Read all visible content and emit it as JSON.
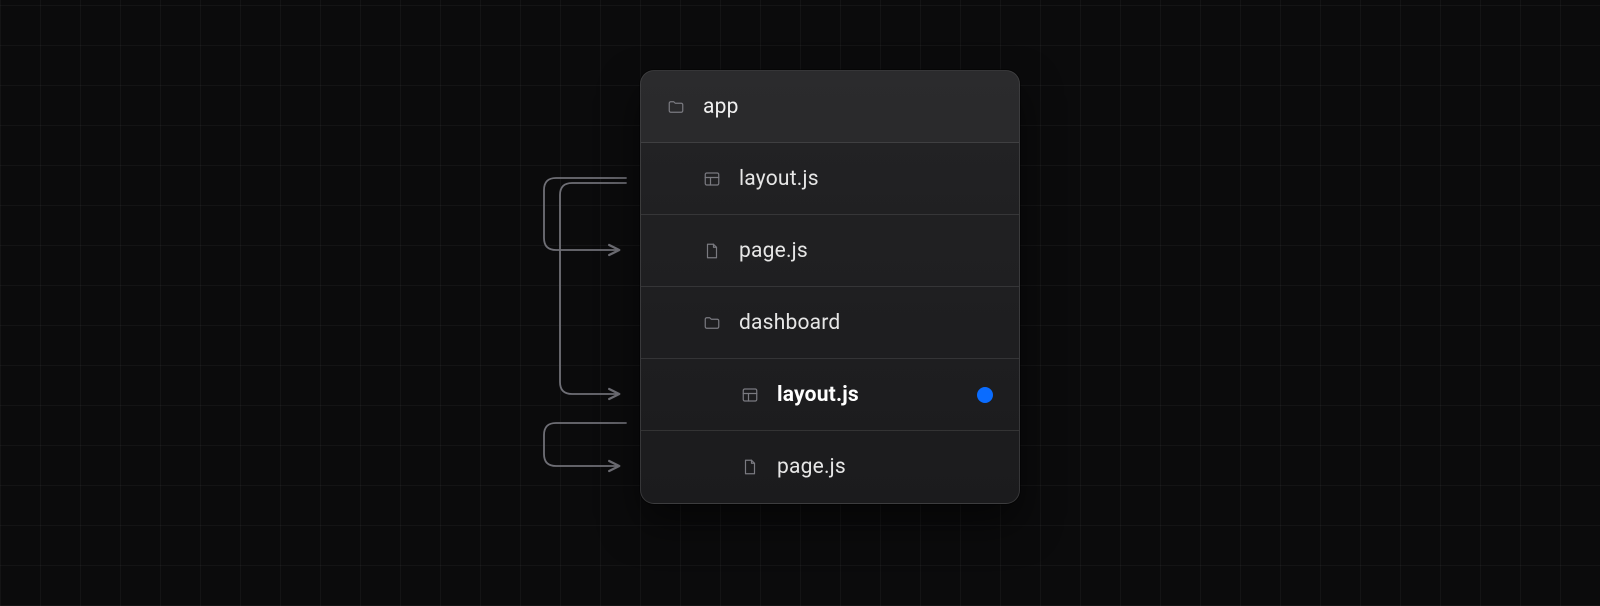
{
  "tree": {
    "root": {
      "label": "app",
      "icon": "folder"
    },
    "items": [
      {
        "label": "layout.js",
        "icon": "layout",
        "depth": 1,
        "active": false
      },
      {
        "label": "page.js",
        "icon": "file",
        "depth": 1,
        "active": false
      },
      {
        "label": "dashboard",
        "icon": "folder",
        "depth": 1,
        "active": false
      },
      {
        "label": "layout.js",
        "icon": "layout",
        "depth": 2,
        "active": true,
        "indicator": "blue"
      },
      {
        "label": "page.js",
        "icon": "file",
        "depth": 2,
        "active": false
      }
    ]
  },
  "colors": {
    "indicator_blue": "#0a6cff",
    "panel_border": "rgba(255,255,255,0.12)",
    "bg": "#0b0b0c"
  }
}
